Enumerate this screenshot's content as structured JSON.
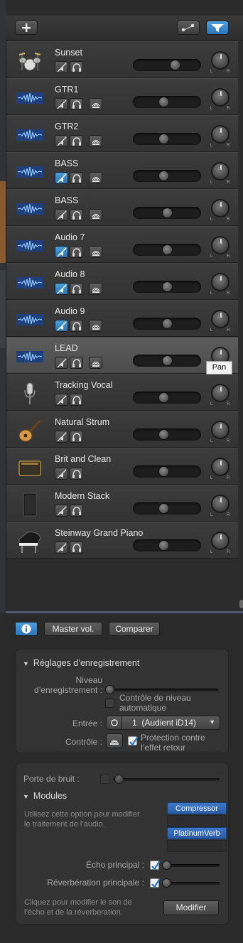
{
  "toolbar": {
    "add_icon": "plus-icon",
    "smart_icon": "connector-icon",
    "filter_icon": "filter-icon"
  },
  "tracks": [
    {
      "name": "Sunset",
      "icon": "drum-kit-icon",
      "mute_on": false,
      "has_monitor": false,
      "volume": 0.66,
      "pan_icon": "knob"
    },
    {
      "name": "GTR1",
      "icon": "waveform-icon",
      "mute_on": false,
      "has_monitor": true,
      "volume": 0.45
    },
    {
      "name": "GTR2",
      "icon": "waveform-icon",
      "mute_on": false,
      "has_monitor": true,
      "volume": 0.45
    },
    {
      "name": "BASS",
      "icon": "waveform-icon",
      "mute_on": true,
      "has_monitor": true,
      "volume": 0.45
    },
    {
      "name": "BASS",
      "icon": "waveform-icon",
      "mute_on": false,
      "has_monitor": true,
      "volume": 0.52
    },
    {
      "name": "Audio 7",
      "icon": "waveform-icon",
      "mute_on": true,
      "has_monitor": true,
      "volume": 0.52
    },
    {
      "name": "Audio 8",
      "icon": "waveform-icon",
      "mute_on": true,
      "has_monitor": true,
      "volume": 0.52
    },
    {
      "name": "Audio 9",
      "icon": "waveform-icon",
      "mute_on": true,
      "has_monitor": true,
      "volume": 0.52
    },
    {
      "name": "LEAD",
      "icon": "waveform-icon",
      "mute_on": false,
      "has_monitor": true,
      "volume": 0.52,
      "selected": true
    },
    {
      "name": "Tracking Vocal",
      "icon": "microphone-icon",
      "mute_on": false,
      "has_monitor": false,
      "volume": 0.45
    },
    {
      "name": "Natural Strum",
      "icon": "acoustic-guitar-icon",
      "mute_on": false,
      "has_monitor": false,
      "volume": 0.45
    },
    {
      "name": "Brit and Clean",
      "icon": "amp-icon",
      "mute_on": false,
      "has_monitor": false,
      "volume": 0.45
    },
    {
      "name": "Modern Stack",
      "icon": "speaker-cabinet-icon",
      "mute_on": false,
      "has_monitor": false,
      "volume": 0.45
    },
    {
      "name": "Steinway Grand Piano",
      "icon": "grand-piano-icon",
      "mute_on": false,
      "has_monitor": false,
      "volume": 0.45
    }
  ],
  "pan_labels": {
    "left": "L",
    "right": "R"
  },
  "tooltip": "Pan",
  "inspector": {
    "info_icon": "info-icon",
    "master_vol": "Master vol.",
    "compare": "Comparer",
    "rec_section": {
      "title": "Réglages d’enregistrement",
      "level_label_1": "Niveau",
      "level_label_2": "d’enregistrement :",
      "auto_level_1": "Contrôle de niveau",
      "auto_level_2": "automatique",
      "input_label": "Entrée :",
      "input_value": "1  (Audient iD14)",
      "monitor_label": "Contrôle :",
      "feedback_1": "Protection contre",
      "feedback_2": "l’effet retour"
    },
    "noise_gate_label": "Porte de bruit :",
    "modules_title": "Modules",
    "modules_hint_1": "Utilisez cette option pour modifier",
    "modules_hint_2": "le traitement de l’audio.",
    "plugins": [
      "Compressor",
      "PlatinumVerb"
    ],
    "echo_label": "Écho principal :",
    "reverb_label": "Réverbération principale :",
    "edit_hint_1": "Cliquez pour modifier le son de",
    "edit_hint_2": "l’écho et de la réverbération.",
    "edit_button": "Modifier"
  }
}
